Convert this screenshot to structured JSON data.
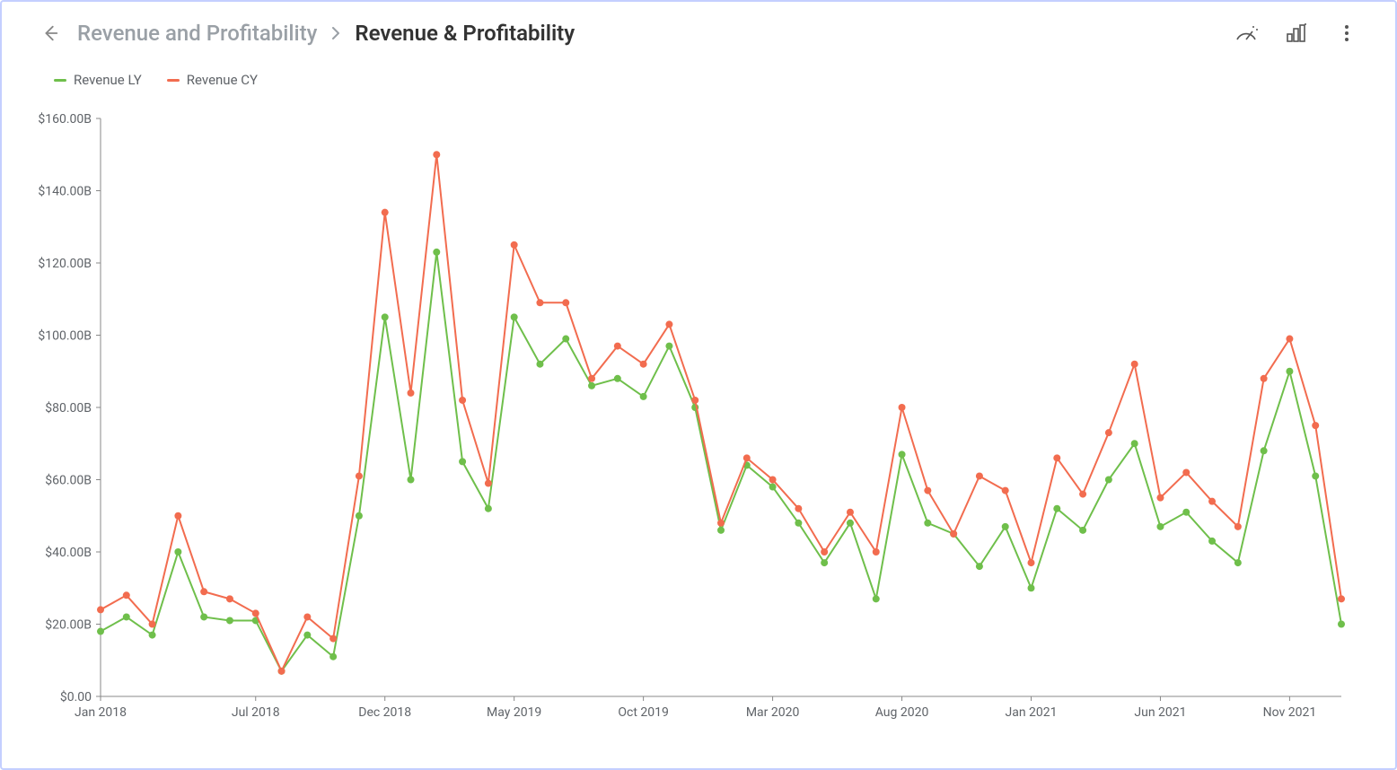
{
  "header": {
    "breadcrumb_parent": "Revenue and Profitability",
    "breadcrumb_current": "Revenue & Profitability"
  },
  "legend": {
    "series1_label": "Revenue LY",
    "series2_label": "Revenue CY"
  },
  "colors": {
    "series1": "#6fbf4b",
    "series2": "#f26c4f",
    "frame_border": "#c4cfff",
    "muted_text": "#9aa0a6",
    "text": "#333"
  },
  "chart_data": {
    "type": "line",
    "xlabel": "",
    "ylabel": "",
    "ylim": [
      0,
      160
    ],
    "y_ticks": [
      0,
      20,
      40,
      60,
      80,
      100,
      120,
      140,
      160
    ],
    "y_tick_labels": [
      "$0.00",
      "$20.00B",
      "$40.00B",
      "$60.00B",
      "$80.00B",
      "$100.00B",
      "$120.00B",
      "$140.00B",
      "$160.00B"
    ],
    "x_tick_indices": [
      0,
      6,
      11,
      16,
      21,
      26,
      31,
      36,
      41,
      46
    ],
    "x_tick_labels": [
      "Jan 2018",
      "Jul 2018",
      "Dec 2018",
      "May 2019",
      "Oct 2019",
      "Mar 2020",
      "Aug 2020",
      "Jan 2021",
      "Jun 2021",
      "Nov 2021"
    ],
    "n_points": 48,
    "series": [
      {
        "name": "Revenue LY",
        "color": "#6fbf4b",
        "values": [
          18,
          22,
          17,
          40,
          22,
          21,
          21,
          7,
          17,
          11,
          50,
          105,
          60,
          123,
          65,
          52,
          105,
          92,
          99,
          86,
          88,
          83,
          97,
          80,
          46,
          64,
          58,
          48,
          37,
          48,
          27,
          67,
          48,
          45,
          36,
          47,
          30,
          52,
          46,
          60,
          70,
          47,
          51,
          43,
          37,
          68,
          90,
          61,
          20
        ]
      },
      {
        "name": "Revenue CY",
        "color": "#f26c4f",
        "values": [
          24,
          28,
          20,
          50,
          29,
          27,
          23,
          7,
          22,
          16,
          61,
          134,
          84,
          150,
          82,
          59,
          125,
          109,
          109,
          88,
          97,
          92,
          103,
          82,
          48,
          66,
          60,
          52,
          40,
          51,
          40,
          80,
          57,
          45,
          61,
          57,
          37,
          66,
          56,
          73,
          92,
          55,
          62,
          54,
          47,
          88,
          99,
          75,
          27
        ]
      }
    ]
  }
}
